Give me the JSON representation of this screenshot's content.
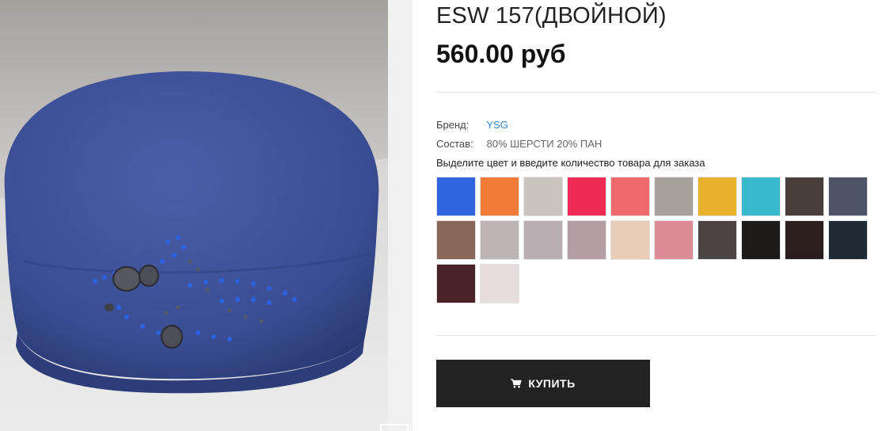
{
  "product": {
    "title": "ESW 157(ДВОЙНОЙ)",
    "price": "560.00 руб",
    "image_description": "blue knitted beret with embellishment"
  },
  "specs": {
    "brand_label": "Бренд:",
    "brand_value": "YSG",
    "composition_label": "Состав:",
    "composition_value": "80% ШЕРСТИ 20% ПАН"
  },
  "instruction": "Выделите цвет и введите количество товара для заказа",
  "colors": {
    "link": "#2f88d0",
    "button": "#222222",
    "swatches": [
      "#2f66e0",
      "#f07a38",
      "#c9c5bd",
      "#ef2b55",
      "#ee6a6c",
      "#a7a39c",
      "#e8b22a",
      "#37b8cc",
      "#4a3e3a",
      "#4c5466",
      "#8a6858",
      "#bdb5b3",
      "#b9aeb2",
      "#b39ea4",
      "#e8cdb8",
      "#dc8a95",
      "#4c4443",
      "#1d1a1a",
      "#2b1d1b",
      "#1f2a34",
      "#4a2329",
      "#e6dedc"
    ]
  },
  "buy": {
    "label": "КУПИТЬ",
    "icon": "cart-icon"
  }
}
